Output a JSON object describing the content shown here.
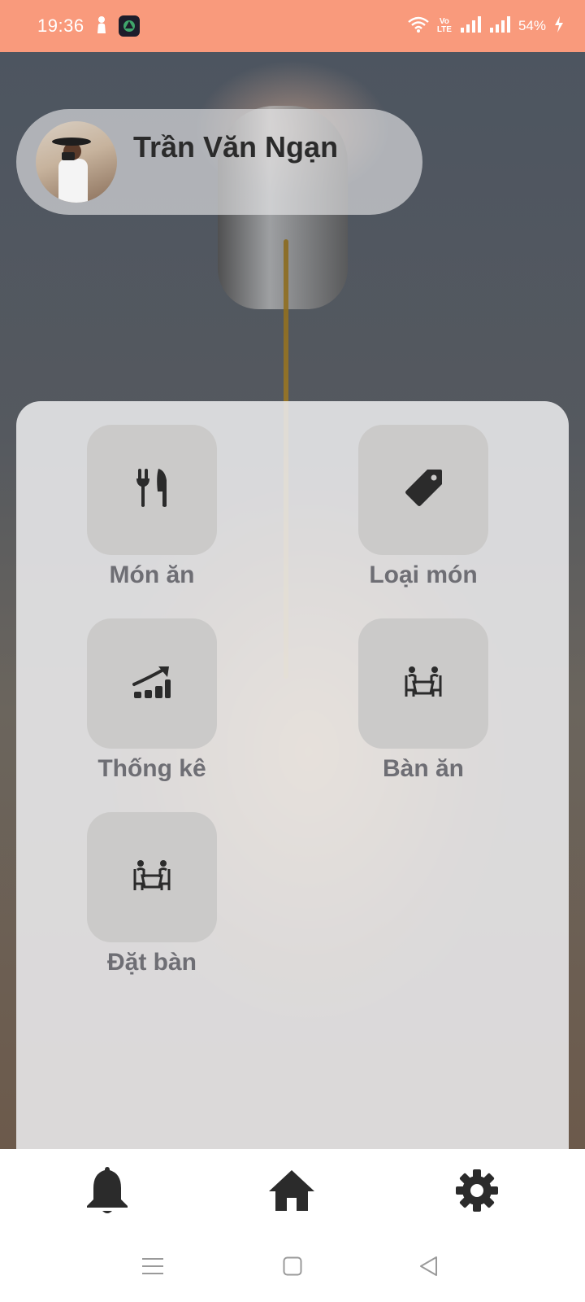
{
  "status_bar": {
    "time": "19:36",
    "battery_text": "54%",
    "volte_label": "Vo\nLTE",
    "icons": [
      "person-icon",
      "app-icon",
      "wifi-icon",
      "signal-icon",
      "signal-icon",
      "charging-icon"
    ]
  },
  "profile": {
    "name": "Trần Văn Ngạn"
  },
  "menu": {
    "items": [
      {
        "label": "Món ăn",
        "icon": "fork-knife-icon"
      },
      {
        "label": "Loại món",
        "icon": "tag-icon"
      },
      {
        "label": "Thống kê",
        "icon": "chart-trend-icon"
      },
      {
        "label": "Bàn ăn",
        "icon": "dining-table-icon"
      },
      {
        "label": "Đặt bàn",
        "icon": "reserve-table-icon"
      }
    ]
  },
  "bottom_nav": {
    "items": [
      {
        "name": "notifications",
        "icon": "bell-icon"
      },
      {
        "name": "home",
        "icon": "home-icon"
      },
      {
        "name": "settings",
        "icon": "gear-icon"
      }
    ]
  },
  "colors": {
    "status_bar": "#f99a7c",
    "tile": "#cbcac9",
    "label": "#6e6e74",
    "icon": "#2b2b2b"
  }
}
